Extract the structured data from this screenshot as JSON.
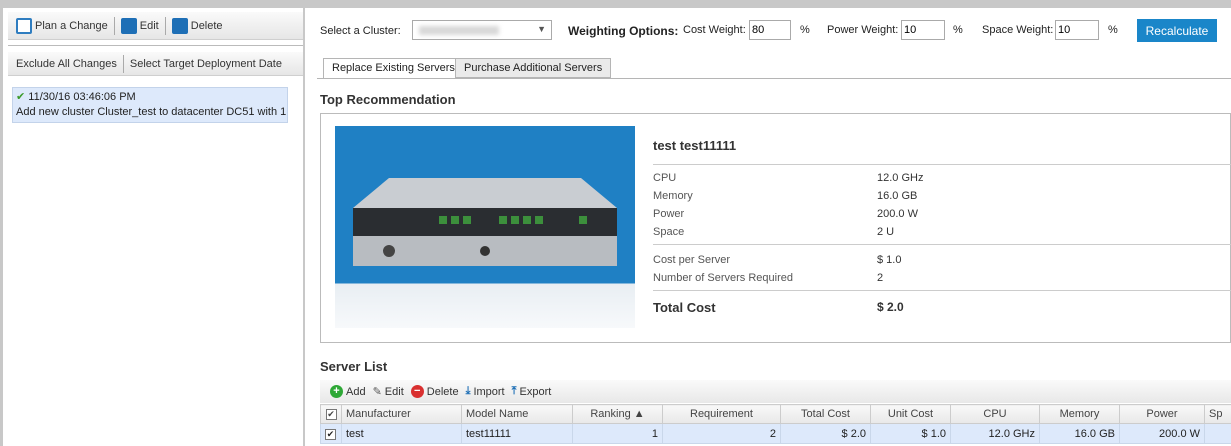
{
  "left": {
    "toolbar": {
      "plan": "Plan a Change",
      "edit": "Edit",
      "delete": "Delete"
    },
    "toolbar2": {
      "exclude": "Exclude All Changes",
      "select_date": "Select Target Deployment Date"
    },
    "changes": [
      {
        "timestamp": "11/30/16 03:46:06 PM",
        "description": "Add new cluster Cluster_test to datacenter DC51 with 1"
      }
    ]
  },
  "header": {
    "cluster_label": "Select a Cluster:",
    "cluster_value": "",
    "weighting_label": "Weighting Options:",
    "cost_label": "Cost Weight:",
    "cost_value": "80",
    "power_label": "Power Weight:",
    "power_value": "10",
    "space_label": "Space Weight:",
    "space_value": "10",
    "percent": "%",
    "recalculate": "Recalculate"
  },
  "tabs": [
    {
      "label": "Replace Existing Servers",
      "active": true
    },
    {
      "label": "Purchase Additional Servers",
      "active": false
    }
  ],
  "recommendation": {
    "title": "Top Recommendation",
    "name": "test test11111",
    "specs": [
      {
        "k": "CPU",
        "v": "12.0 GHz"
      },
      {
        "k": "Memory",
        "v": "16.0 GB"
      },
      {
        "k": "Power",
        "v": "200.0 W"
      },
      {
        "k": "Space",
        "v": "2 U"
      }
    ],
    "costs": [
      {
        "k": "Cost per Server",
        "v": "$ 1.0"
      },
      {
        "k": "Number of Servers Required",
        "v": "2"
      }
    ],
    "total_label": "Total Cost",
    "total_value": "$ 2.0"
  },
  "server_list": {
    "title": "Server List",
    "toolbar": {
      "add": "Add",
      "edit": "Edit",
      "delete": "Delete",
      "import": "Import",
      "export": "Export"
    },
    "columns": [
      "Manufacturer",
      "Model Name",
      "Ranking ▲",
      "Requirement",
      "Total Cost",
      "Unit Cost",
      "CPU",
      "Memory",
      "Power",
      "Sp"
    ],
    "rows": [
      [
        "test",
        "test11111",
        "1",
        "2",
        "$ 2.0",
        "$ 1.0",
        "12.0 GHz",
        "16.0 GB",
        "200.0 W",
        ""
      ]
    ]
  },
  "colors": {
    "accent": "#1a86c9",
    "selected_row": "#dde9fb"
  }
}
